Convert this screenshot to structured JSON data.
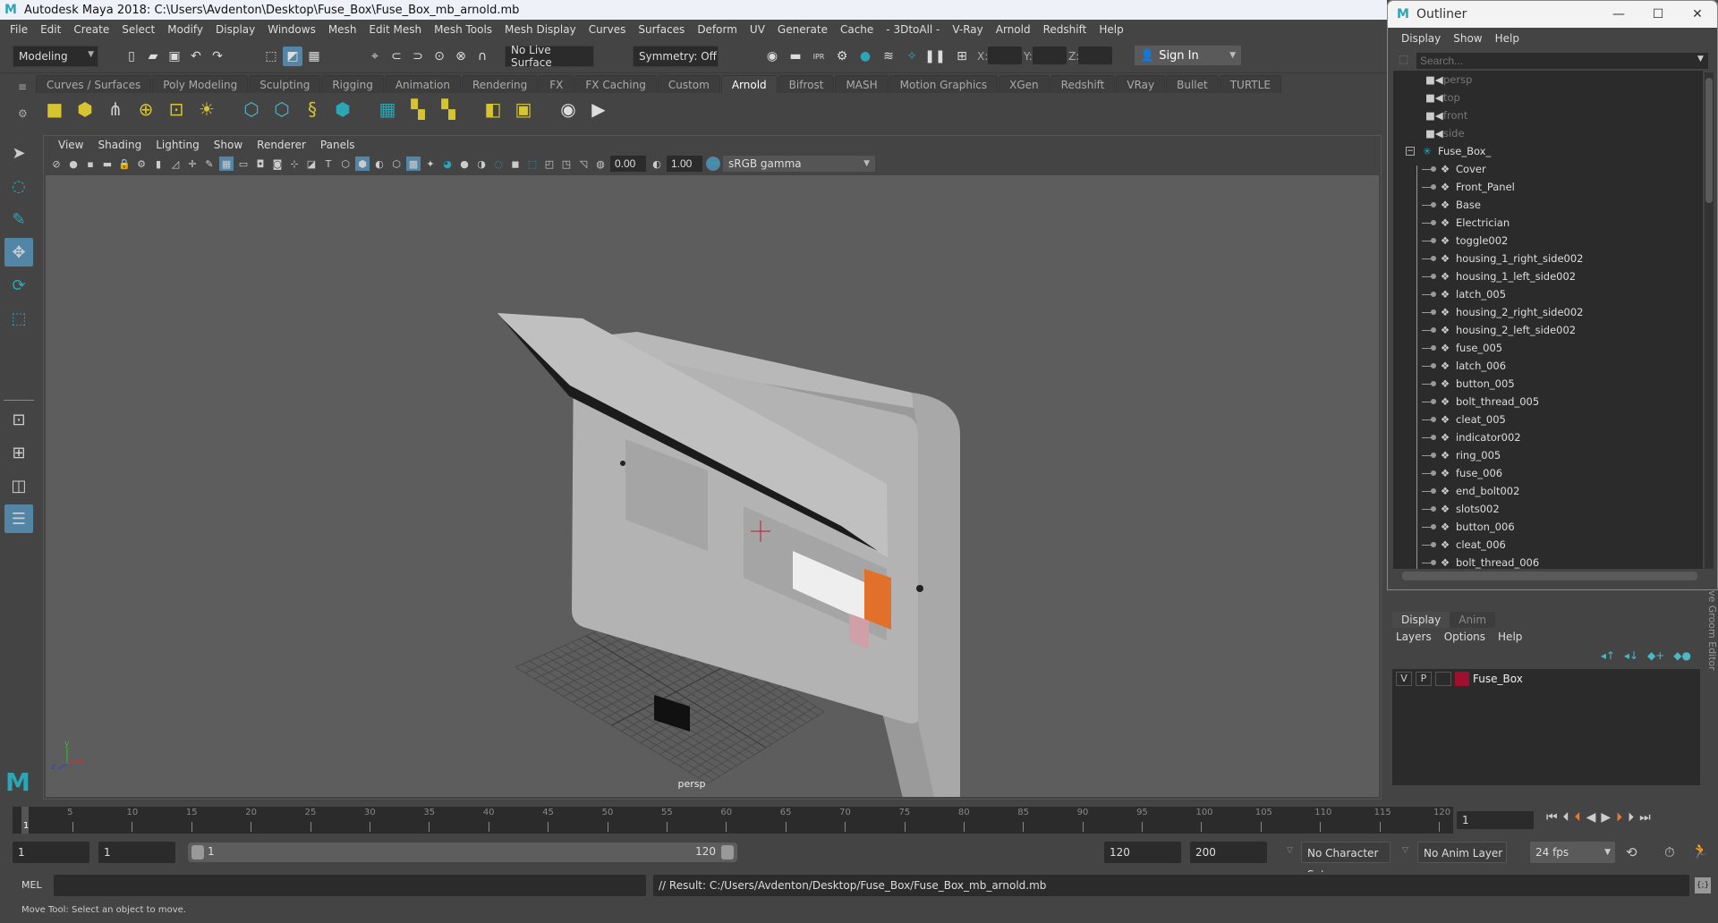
{
  "window": {
    "title": "Autodesk Maya 2018: C:\\Users\\Avdenton\\Desktop\\Fuse_Box\\Fuse_Box_mb_arnold.mb",
    "logo": "M"
  },
  "menubar": [
    "File",
    "Edit",
    "Create",
    "Select",
    "Modify",
    "Display",
    "Windows",
    "Mesh",
    "Edit Mesh",
    "Mesh Tools",
    "Mesh Display",
    "Curves",
    "Surfaces",
    "Deform",
    "UV",
    "Generate",
    "Cache",
    "- 3DtoAll -",
    "V-Ray",
    "Arnold",
    "Redshift",
    "Help"
  ],
  "statusline": {
    "menu_set": "Modeling",
    "live_surface": "No Live Surface",
    "symmetry": "Symmetry: Off",
    "x_label": "X:",
    "y_label": "Y:",
    "z_label": "Z:",
    "x_value": "",
    "y_value": "",
    "z_value": "",
    "sign_in": "Sign In"
  },
  "shelf": {
    "tabs": [
      "Curves / Surfaces",
      "Poly Modeling",
      "Sculpting",
      "Rigging",
      "Animation",
      "Rendering",
      "FX",
      "FX Caching",
      "Custom",
      "Arnold",
      "Bifrost",
      "MASH",
      "Motion Graphics",
      "XGen",
      "Redshift",
      "VRay",
      "Bullet",
      "TURTLE"
    ],
    "active_tab": "Arnold",
    "icons": [
      "area-light",
      "mesh-light",
      "photometric-light",
      "skydome-light",
      "skydome-light-image",
      "physical-sky",
      "standin-create",
      "standin-export",
      "curve-collector",
      "volume",
      "render-view",
      "flush-texture-cache",
      "tx-manager",
      "light-manager",
      "texture-manager",
      "render-eye",
      "render-play"
    ]
  },
  "viewport": {
    "menu": [
      "View",
      "Shading",
      "Lighting",
      "Show",
      "Renderer",
      "Panels"
    ],
    "exposure": "0.00",
    "gamma": "1.00",
    "color_space": "sRGB gamma",
    "camera_label": "persp",
    "axis": {
      "x": "x",
      "y": "y",
      "z": "z"
    }
  },
  "toolbox": [
    "select-tool",
    "lasso-tool",
    "paint-select-tool",
    "move-tool",
    "rotate-tool",
    "scale-tool"
  ],
  "outliner": {
    "title": "Outliner",
    "menu": [
      "Display",
      "Show",
      "Help"
    ],
    "search_placeholder": "Search...",
    "cameras": [
      "persp",
      "top",
      "front",
      "side"
    ],
    "group": "Fuse_Box_",
    "children": [
      "Cover",
      "Front_Panel",
      "Base",
      "Electrician",
      "toggle002",
      "housing_1_right_side002",
      "housing_1_left_side002",
      "latch_005",
      "housing_2_right_side002",
      "housing_2_left_side002",
      "fuse_005",
      "latch_006",
      "button_005",
      "bolt_thread_005",
      "cleat_005",
      "indicator002",
      "ring_005",
      "fuse_006",
      "end_bolt002",
      "slots002",
      "button_006",
      "cleat_006",
      "bolt_thread_006"
    ]
  },
  "side_tab": "ve Groom Editor",
  "layer_editor": {
    "tabs": [
      "Display",
      "Anim"
    ],
    "active_tab": "Display",
    "menu": [
      "Layers",
      "Options",
      "Help"
    ],
    "layers": [
      {
        "v": "V",
        "p": "P",
        "name": "Fuse_Box",
        "color": "#a0102e"
      }
    ]
  },
  "timeline": {
    "ticks": [
      "5",
      "10",
      "15",
      "20",
      "25",
      "30",
      "35",
      "40",
      "45",
      "50",
      "55",
      "60",
      "65",
      "70",
      "75",
      "80",
      "85",
      "90",
      "95",
      "100",
      "105",
      "110",
      "115",
      "120"
    ],
    "current_frame_marker": "1",
    "current_frame": "1",
    "start_min": "1",
    "start": "1",
    "range_start_label": "1",
    "range_end_label": "120",
    "end": "120",
    "end_max": "200",
    "character_set": "No Character Set",
    "anim_layer": "No Anim Layer",
    "fps": "24 fps"
  },
  "command_line": {
    "lang": "MEL",
    "input": "",
    "result": "// Result: C:/Users/Avdenton/Desktop/Fuse_Box/Fuse_Box_mb_arnold.mb"
  },
  "help_line": "Move Tool: Select an object to move.",
  "colors": {
    "accent": "#5285a6",
    "arnold_teal": "#2aa6b5",
    "layer_color": "#a0102e",
    "playhead": "#e07b39"
  }
}
